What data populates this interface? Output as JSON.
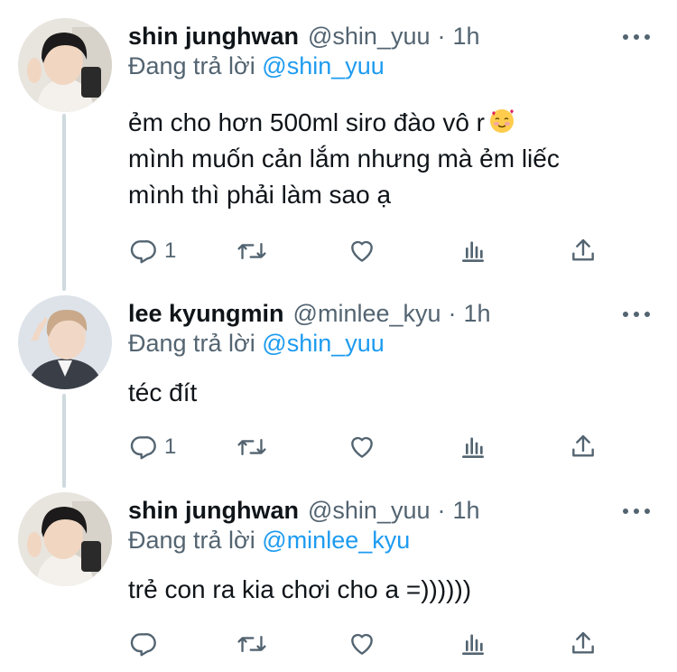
{
  "tweets": [
    {
      "name": "shin junghwan",
      "handle": "@shin_yuu",
      "dot": "·",
      "time": "1h",
      "reply_prefix": "Đang trả lời",
      "reply_mention": "@shin_yuu",
      "lines": [
        "ẻm cho hơn 500ml siro đào vô r",
        "mình muốn cản lắm nhưng mà ẻm liếc",
        "mình thì phải làm sao ạ"
      ],
      "emoji": "smiling-face-with-hearts",
      "reply_count": "1"
    },
    {
      "name": "lee kyungmin",
      "handle": "@minlee_kyu",
      "dot": "·",
      "time": "1h",
      "reply_prefix": "Đang trả lời",
      "reply_mention": "@shin_yuu",
      "lines": [
        "téc đít"
      ],
      "reply_count": "1"
    },
    {
      "name": "shin junghwan",
      "handle": "@shin_yuu",
      "dot": "·",
      "time": "1h",
      "reply_prefix": "Đang trả lời",
      "reply_mention": "@minlee_kyu",
      "lines": [
        "trẻ con ra kia chơi cho a =))))))"
      ],
      "reply_count": ""
    }
  ],
  "icons": {
    "reply": "reply-icon",
    "retweet": "retweet-icon",
    "like": "heart-icon",
    "analytics": "analytics-icon",
    "share": "share-icon",
    "more": "more-icon"
  },
  "colors": {
    "link": "#1d9bf0",
    "secondary": "#536471",
    "text": "#0f1419",
    "thread_line": "#cfd9de"
  }
}
